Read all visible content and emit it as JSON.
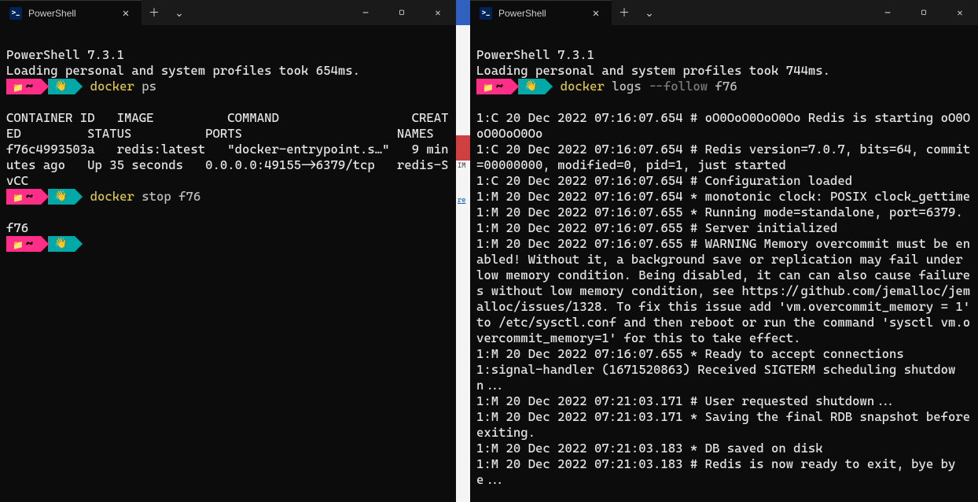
{
  "left": {
    "tab": {
      "title": "PowerShell",
      "icon": ">_"
    },
    "ps_version": "PowerShell 7.3.1",
    "profile_load": "Loading personal and system profiles took 654ms.",
    "prompt": {
      "folder": "~",
      "wave": "👋"
    },
    "cmd1": {
      "docker": "docker",
      "args": "ps"
    },
    "ps_header": "CONTAINER ID   IMAGE          COMMAND                  CREATED         STATUS          PORTS                     NAMES",
    "ps_row": "f76c4993503a   redis:latest   \"docker-entrypoint.s…\"   9 minutes ago   Up 35 seconds   0.0.0.0:49155->6379/tcp   redis-SvCC",
    "cmd2": {
      "docker": "docker",
      "args": "stop f76"
    },
    "stop_out": "f76"
  },
  "right": {
    "tab": {
      "title": "PowerShell",
      "icon": ">_"
    },
    "ps_version": "PowerShell 7.3.1",
    "profile_load": "Loading personal and system profiles took 744ms.",
    "prompt": {
      "folder": "~",
      "wave": "👋"
    },
    "cmd1": {
      "docker": "docker",
      "sub": "logs",
      "flag": "--follow",
      "arg": "f76"
    },
    "log_lines": [
      "1:C 20 Dec 2022 07:16:07.654 # oO0OoO0OoO0Oo Redis is starting oO0OoO0OoO0Oo",
      "1:C 20 Dec 2022 07:16:07.654 # Redis version=7.0.7, bits=64, commit=00000000, modified=0, pid=1, just started",
      "1:C 20 Dec 2022 07:16:07.654 # Configuration loaded",
      "1:M 20 Dec 2022 07:16:07.654 * monotonic clock: POSIX clock_gettime",
      "1:M 20 Dec 2022 07:16:07.655 * Running mode=standalone, port=6379.",
      "1:M 20 Dec 2022 07:16:07.655 # Server initialized",
      "1:M 20 Dec 2022 07:16:07.655 # WARNING Memory overcommit must be enabled! Without it, a background save or replication may fail under low memory condition. Being disabled, it can can also cause failures without low memory condition, see https://github.com/jemalloc/jemalloc/issues/1328. To fix this issue add 'vm.overcommit_memory = 1' to /etc/sysctl.conf and then reboot or run the command 'sysctl vm.overcommit_memory=1' for this to take effect.",
      "1:M 20 Dec 2022 07:16:07.655 * Ready to accept connections",
      "1:signal-handler (1671520863) Received SIGTERM scheduling shutdown...",
      "1:M 20 Dec 2022 07:21:03.171 # User requested shutdown...",
      "1:M 20 Dec 2022 07:21:03.171 * Saving the final RDB snapshot before exiting.",
      "1:M 20 Dec 2022 07:21:03.183 * DB saved on disk",
      "1:M 20 Dec 2022 07:21:03.183 # Redis is now ready to exit, bye bye..."
    ]
  },
  "gap": {
    "im": "IM",
    "re": "re"
  },
  "glyphs": {
    "close_x": "✕",
    "plus": "＋",
    "chevron": "⌄",
    "min": "—",
    "max": "▢",
    "winclose": "✕"
  }
}
